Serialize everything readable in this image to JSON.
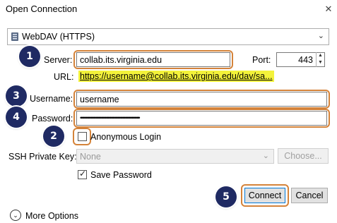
{
  "window": {
    "title": "Open Connection",
    "close_glyph": "✕"
  },
  "protocol": {
    "selected": "WebDAV (HTTPS)"
  },
  "server": {
    "label": "Server:",
    "value": "collab.its.virginia.edu"
  },
  "port": {
    "label": "Port:",
    "value": "443"
  },
  "url": {
    "label": "URL:",
    "value": "https://username@collab.its.virginia.edu/dav/sa..."
  },
  "username": {
    "label": "Username:",
    "value": "username"
  },
  "password": {
    "label": "Password:",
    "value": "••••••••••••••••••••••••••••••••••••••••••••••••••••••••••••••"
  },
  "anonymous": {
    "label": "Anonymous Login",
    "checked": false
  },
  "ssh_key": {
    "label": "SSH Private Key:",
    "value": "None",
    "choose_label": "Choose..."
  },
  "save_password": {
    "label": "Save Password",
    "checked": true
  },
  "buttons": {
    "connect": "Connect",
    "cancel": "Cancel"
  },
  "more_options": {
    "label": "More Options"
  },
  "annotations": {
    "b1": "1",
    "b2": "2",
    "b3": "3",
    "b4": "4",
    "b5": "5"
  },
  "colors": {
    "highlight": "#d4833a",
    "badge": "#1f2a63",
    "url_highlight": "#f3f23a"
  }
}
